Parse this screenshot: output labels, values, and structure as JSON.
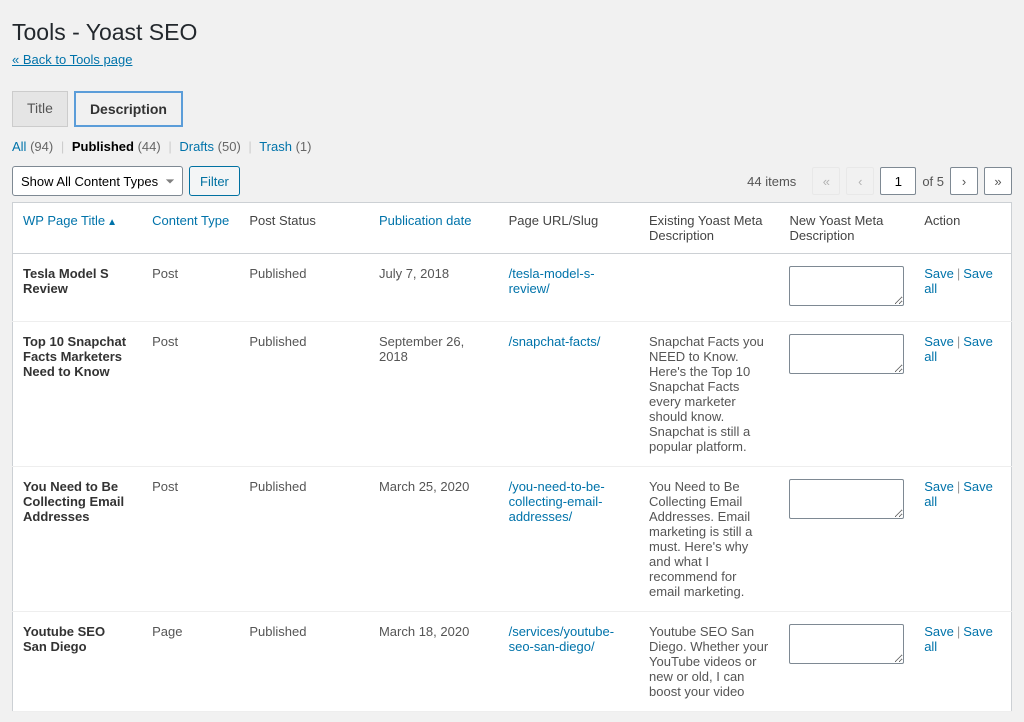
{
  "page": {
    "heading": "Tools - Yoast SEO",
    "back_link": "« Back to Tools page"
  },
  "tabs": [
    {
      "label": "Title",
      "active": false
    },
    {
      "label": "Description",
      "active": true
    }
  ],
  "states": {
    "all_label": "All",
    "all_count": "(94)",
    "published_label": "Published",
    "published_count": "(44)",
    "drafts_label": "Drafts",
    "drafts_count": "(50)",
    "trash_label": "Trash",
    "trash_count": "(1)"
  },
  "filters": {
    "content_type_selected": "Show All Content Types",
    "filter_button": "Filter"
  },
  "pager": {
    "items_text": "44 items",
    "first_glyph": "«",
    "prev_glyph": "‹",
    "current_page": "1",
    "of_text": "of 5",
    "next_glyph": "›",
    "last_glyph": "»"
  },
  "columns": {
    "title": "WP Page Title",
    "content_type": "Content Type",
    "post_status": "Post Status",
    "pub_date": "Publication date",
    "slug": "Page URL/Slug",
    "existing": "Existing Yoast Meta Description",
    "new": "New Yoast Meta Description",
    "action": "Action"
  },
  "sort_indicator": "▲",
  "actions": {
    "save": "Save",
    "save_all": "Save all"
  },
  "rows": [
    {
      "title": "Tesla Model S Review",
      "content_type": "Post",
      "post_status": "Published",
      "pub_date": "July 7, 2018",
      "slug": "/tesla-model-s-review/",
      "existing": "",
      "new": ""
    },
    {
      "title": "Top 10 Snapchat Facts Marketers Need to Know",
      "content_type": "Post",
      "post_status": "Published",
      "pub_date": "September 26, 2018",
      "slug": "/snapchat-facts/",
      "existing": "Snapchat Facts you NEED to Know. Here's the Top 10 Snapchat Facts every marketer should know. Snapchat is still a popular platform.",
      "new": ""
    },
    {
      "title": "You Need to Be Collecting Email Addresses",
      "content_type": "Post",
      "post_status": "Published",
      "pub_date": "March 25, 2020",
      "slug": "/you-need-to-be-collecting-email-addresses/",
      "existing": "You Need to Be Collecting Email Addresses. Email marketing is still a must. Here's why and what I recommend for email marketing.",
      "new": ""
    },
    {
      "title": "Youtube SEO San Diego",
      "content_type": "Page",
      "post_status": "Published",
      "pub_date": "March 18, 2020",
      "slug": "/services/youtube-seo-san-diego/",
      "existing": "Youtube SEO San Diego. Whether your YouTube videos or new or old, I can boost your video",
      "new": ""
    }
  ]
}
